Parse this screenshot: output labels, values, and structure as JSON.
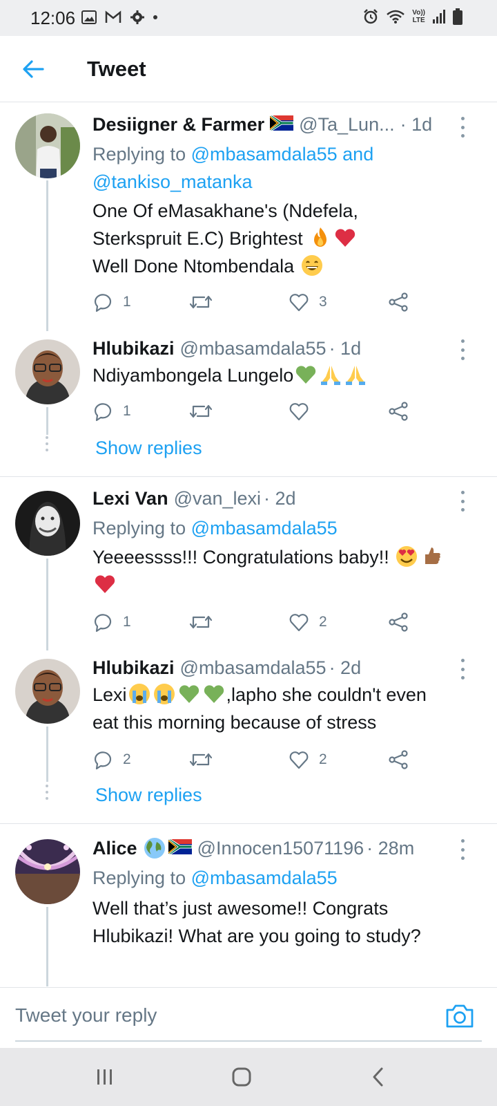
{
  "status_bar": {
    "time": "12:06",
    "icons_left": [
      "image-icon",
      "gmail-icon",
      "settings-icon",
      "dot-icon"
    ],
    "icons_right": [
      "alarm-icon",
      "wifi-icon",
      "volte-icon",
      "signal-icon",
      "battery-icon"
    ],
    "volte_label_1": "Vo))",
    "volte_label_2": "LTE"
  },
  "header": {
    "title": "Tweet"
  },
  "tweets": [
    {
      "name": "Desiigner & Farmer",
      "handle": "@Ta_Lun...",
      "time": "· 1d",
      "reply_prefix": "Replying to",
      "reply_mention_1": "@mbasamdala55",
      "reply_and": "and",
      "reply_mention_2": "@tankiso_matanka",
      "text_line1": "One Of eMasakhane's (Ndefela,",
      "text_line2": "Sterkspruit E.C) Brightest",
      "text_line3": "Well Done Ntombendala",
      "replies": "1",
      "retweets": "",
      "likes": "3"
    },
    {
      "name": "Hlubikazi",
      "handle": "@mbasamdala55",
      "time": "· 1d",
      "text_line1": "Ndiyambongela Lungelo",
      "replies": "1",
      "retweets": "",
      "likes": "",
      "show_replies": "Show replies"
    },
    {
      "name": "Lexi Van",
      "handle": "@van_lexi",
      "time": "· 2d",
      "reply_prefix": "Replying to",
      "reply_mention_1": "@mbasamdala55",
      "text_line1": "Yeeeessss!!! Congratulations baby!!",
      "replies": "1",
      "retweets": "",
      "likes": "2"
    },
    {
      "name": "Hlubikazi",
      "handle": "@mbasamdala55",
      "time": "· 2d",
      "text_line1_a": "Lexi",
      "text_line1_b": ",lapho she couldn't even",
      "text_line2": "eat this morning because of stress",
      "replies": "2",
      "retweets": "",
      "likes": "2",
      "show_replies": "Show replies"
    },
    {
      "name": "Alice",
      "handle": "@Innocen15071196",
      "time": "· 28m",
      "reply_prefix": "Replying to",
      "reply_mention_1": "@mbasamdala55",
      "text_line1": "Well that’s just awesome!! Congrats",
      "text_line2": "Hlubikazi! What are you going to study?"
    }
  ],
  "reply_bar": {
    "placeholder": "Tweet your reply"
  },
  "nav_bar": {
    "buttons": [
      "recent-apps",
      "home",
      "back"
    ]
  },
  "colors": {
    "accent": "#1da1f2",
    "text": "#14171a",
    "secondary": "#657786",
    "divider": "#e1e4e8"
  }
}
